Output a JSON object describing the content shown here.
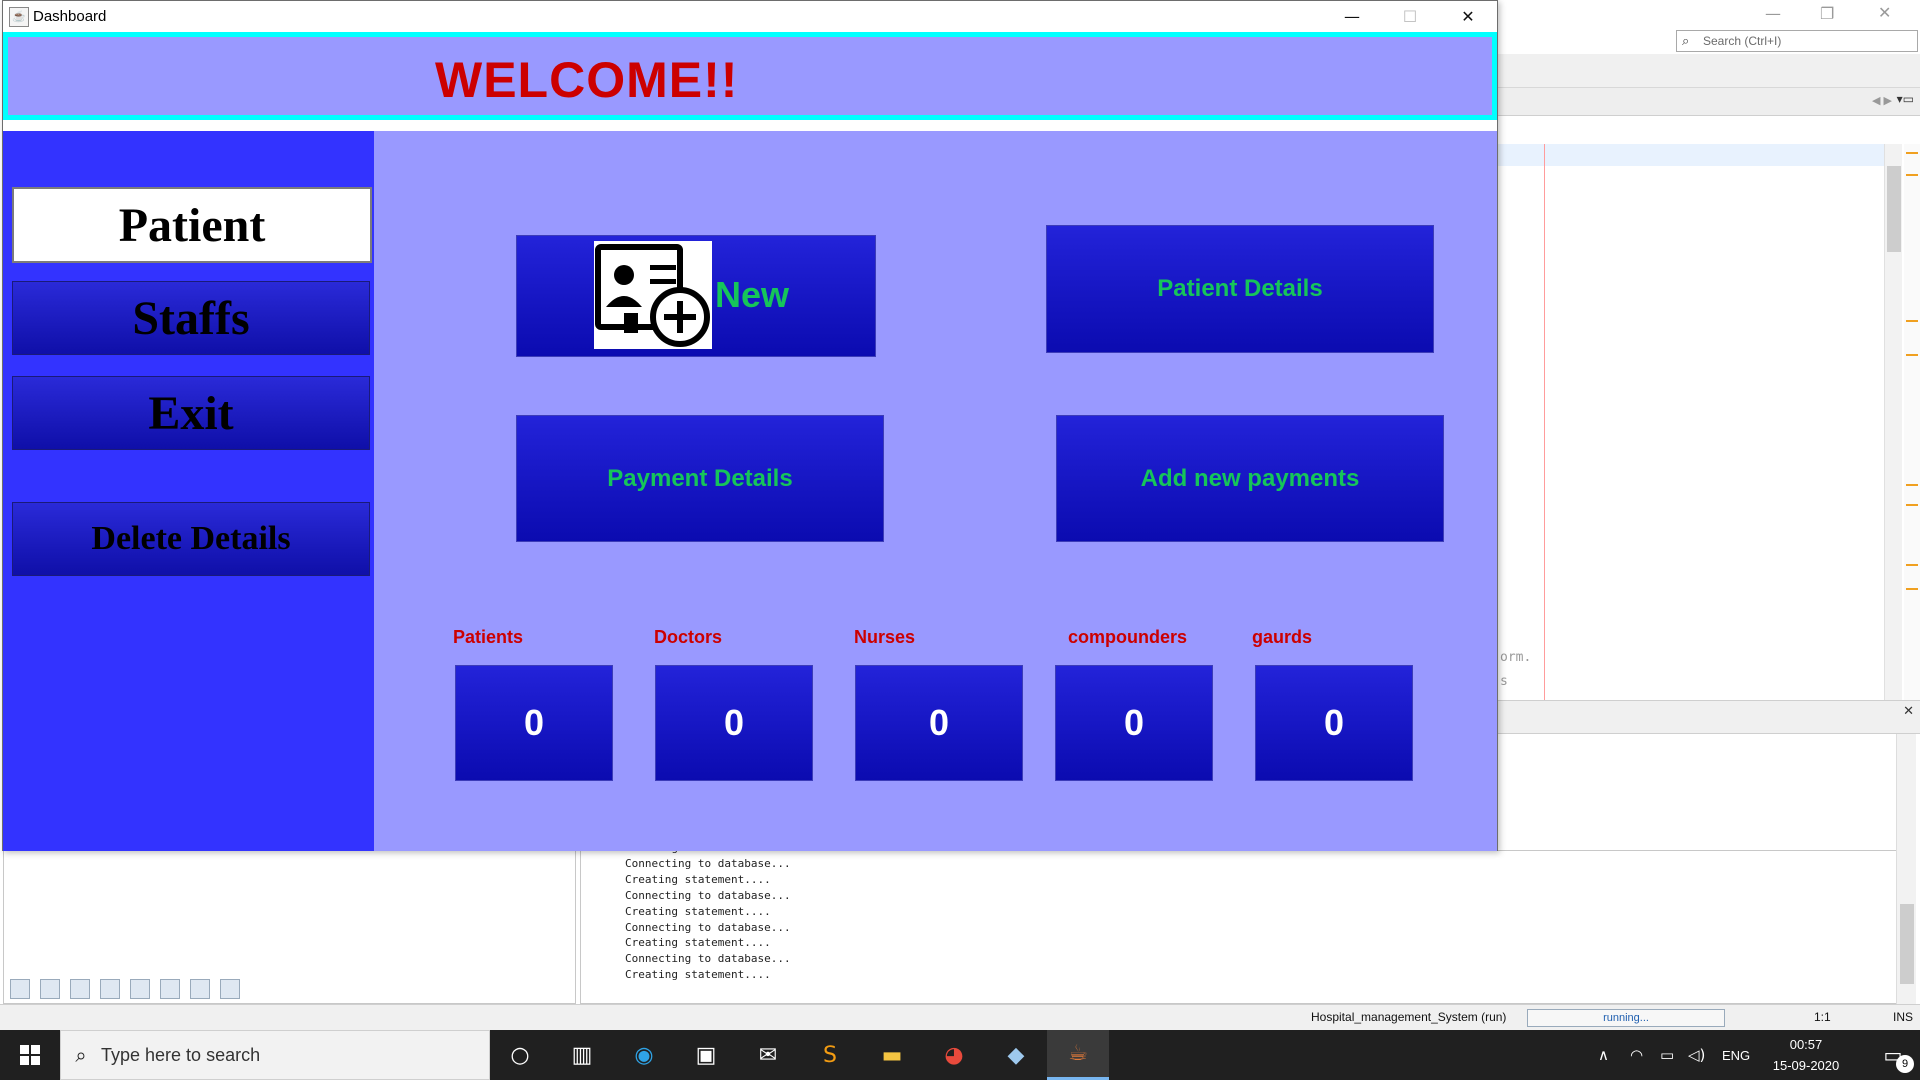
{
  "ide": {
    "search_placeholder": "Search (Ctrl+I)",
    "code_fragment_1": "orm.",
    "code_fragment_2": "s",
    "output_lines": [
      "Creating statement....",
      "Connecting to database...",
      "Creating statement....",
      "Connecting to database...",
      "Creating statement....",
      "Connecting to database...",
      "Creating statement....",
      "Connecting to database...",
      "Creating statement...."
    ],
    "status": {
      "project": "Hospital_management_System (run)",
      "progress": "running...",
      "position": "1:1",
      "mode": "INS"
    }
  },
  "taskbar": {
    "search_placeholder": "Type here to search",
    "tray": {
      "language": "ENG",
      "time": "00:57",
      "date": "15-09-2020",
      "notifications": "9"
    }
  },
  "window": {
    "title": "Dashboard",
    "welcome": "WELCOME!!",
    "sidebar": {
      "patient": "Patient",
      "staffs": "Staffs",
      "exit": "Exit",
      "delete": "Delete Details"
    },
    "actions": {
      "new": "New",
      "patient_details": "Patient Details",
      "payment_details": "Payment Details",
      "add_payments": "Add new payments"
    },
    "stats": [
      {
        "label": "Patients",
        "value": "0"
      },
      {
        "label": "Doctors",
        "value": "0"
      },
      {
        "label": "Nurses",
        "value": "0"
      },
      {
        "label": "compounders",
        "value": "0"
      },
      {
        "label": "gaurds",
        "value": "0"
      }
    ]
  },
  "colors": {
    "banner_bg": "#9999ff",
    "banner_border": "#00ffff",
    "welcome_text": "#cc0000",
    "sidebar_bg": "#3333ff",
    "button_bg": "#1414c8",
    "button_text": "#16c55a",
    "stat_label": "#cc0000"
  }
}
